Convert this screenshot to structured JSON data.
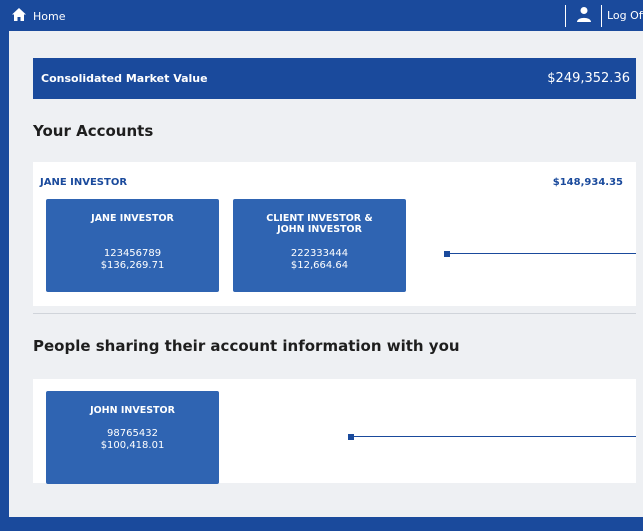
{
  "topbar": {
    "home_label": "Home",
    "logoff_label": "Log Off"
  },
  "market_value": {
    "label": "Consolidated Market Value",
    "value": "$249,352.36"
  },
  "your_accounts": {
    "title": "Your Accounts",
    "owner": "JANE INVESTOR",
    "total": "$148,934.35",
    "tiles": [
      {
        "name": "JANE INVESTOR",
        "number": "123456789",
        "value": "$136,269.71"
      },
      {
        "name": "CLIENT INVESTOR & JOHN INVESTOR",
        "number": "222333444",
        "value": "$12,664.64"
      }
    ]
  },
  "shared": {
    "title": "People sharing their account information with you",
    "tiles": [
      {
        "name": "JOHN INVESTOR",
        "number": "98765432",
        "value": "$100,418.01"
      }
    ]
  },
  "colors": {
    "brand": "#1a4a9c",
    "tile": "#2f64b2",
    "panel": "#eef0f3"
  }
}
